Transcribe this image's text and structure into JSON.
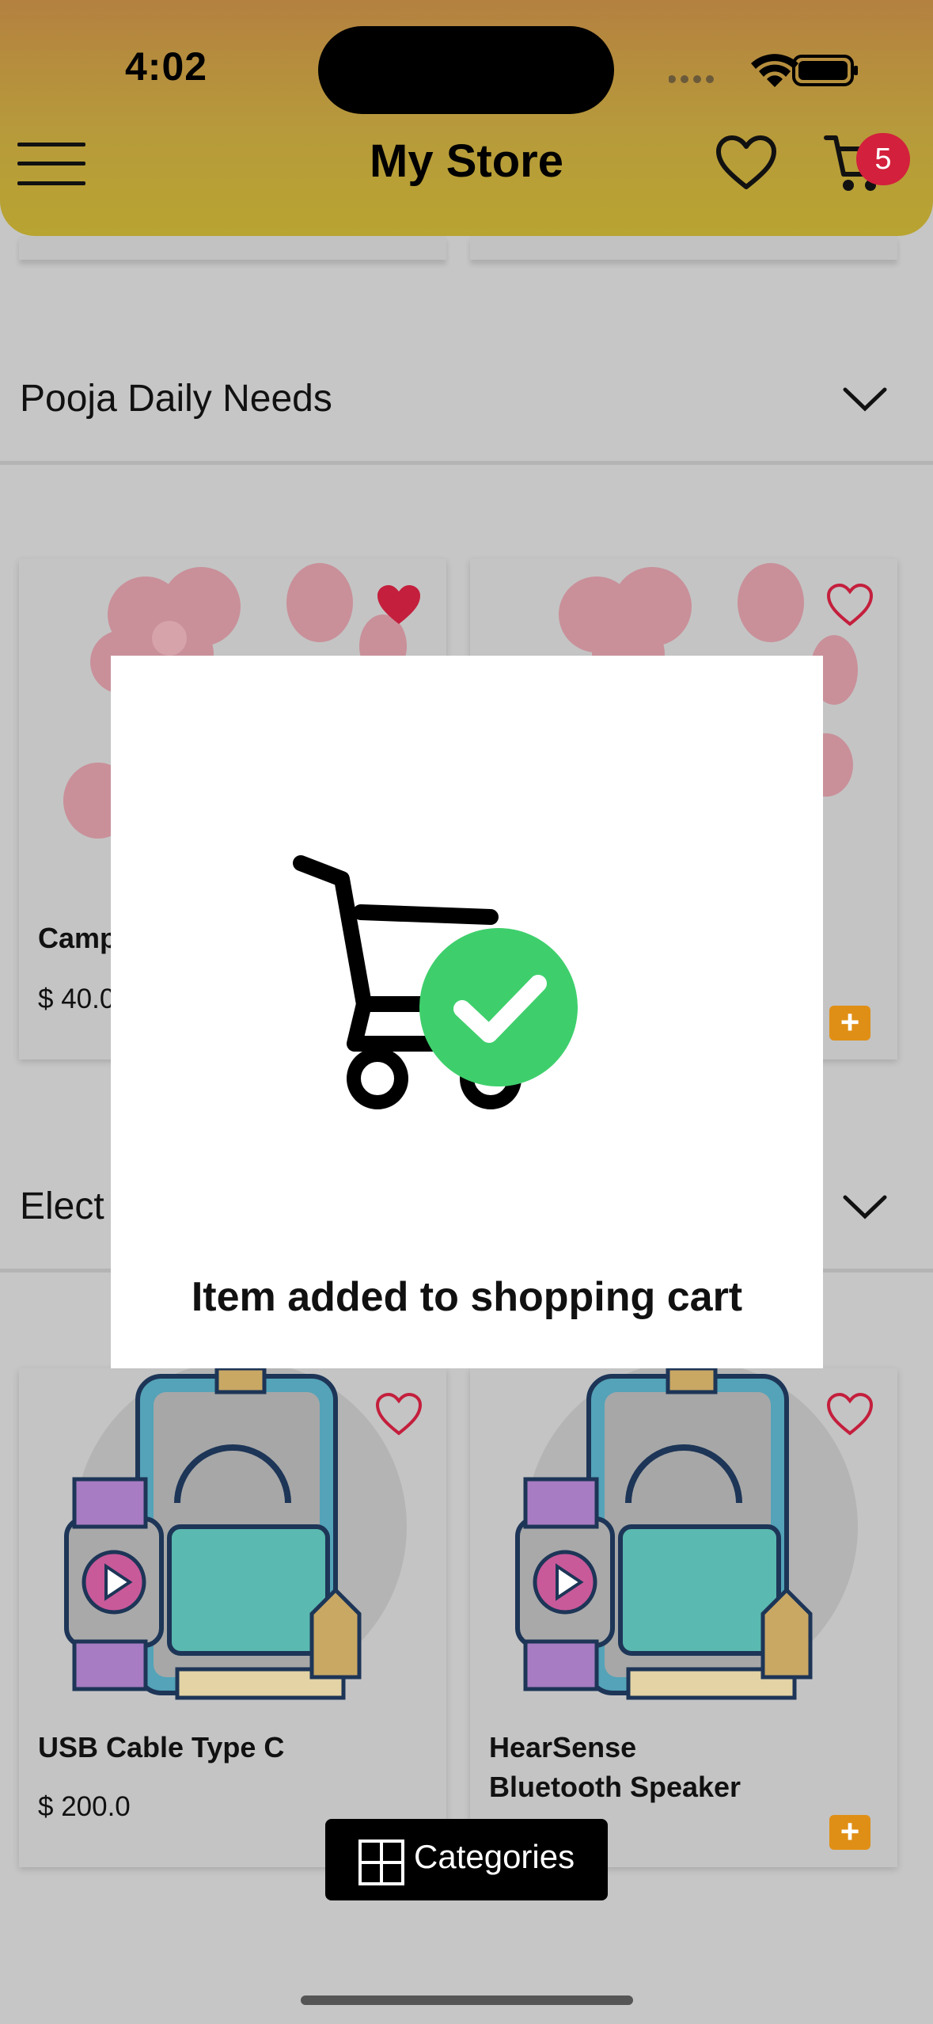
{
  "status_bar": {
    "time": "4:02"
  },
  "header": {
    "title": "My Store",
    "cart_count": "5",
    "accent": "#b8923a"
  },
  "sections": [
    {
      "title": "Pooja Daily Needs"
    },
    {
      "title": "Elect"
    }
  ],
  "pooja_products": [
    {
      "name": "Camp",
      "price": "$ 40.0",
      "favorited": true
    },
    {
      "name": "",
      "price": "",
      "favorited": false
    }
  ],
  "electronics_products": [
    {
      "name": "USB Cable Type C",
      "price": "$ 200.0",
      "favorited": false
    },
    {
      "name": "HearSense\nBluetooth Speaker",
      "price": "",
      "favorited": false
    }
  ],
  "dialog": {
    "message": "Item added to shopping cart",
    "check_color": "#3ecf6c"
  },
  "categories_button": {
    "label": "Categories"
  },
  "colors": {
    "badge": "#d3203c",
    "heart": "#d3203c",
    "plus": "#e08f16"
  }
}
